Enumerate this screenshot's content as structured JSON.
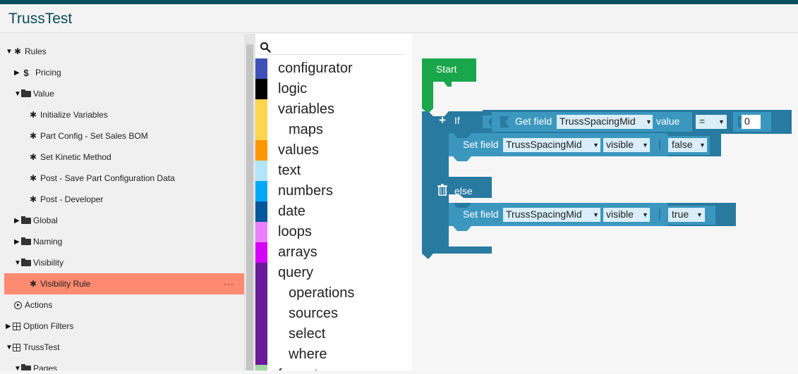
{
  "app": {
    "title": "TrussTest"
  },
  "tree": {
    "items": [
      {
        "label": "Rules",
        "arrow": "▼",
        "icon": "puzzle"
      },
      {
        "label": "Pricing",
        "arrow": "▶",
        "icon": "dollar"
      },
      {
        "label": "Value",
        "arrow": "▼",
        "icon": "folder"
      },
      {
        "label": "Initialize Variables",
        "arrow": "",
        "icon": "puzzle"
      },
      {
        "label": "Part Config - Set Sales BOM",
        "arrow": "",
        "icon": "puzzle"
      },
      {
        "label": "Set Kinetic Method",
        "arrow": "",
        "icon": "puzzle"
      },
      {
        "label": "Post - Save Part Configuration Data",
        "arrow": "",
        "icon": "puzzle"
      },
      {
        "label": "Post - Developer",
        "arrow": "",
        "icon": "puzzle"
      },
      {
        "label": "Global",
        "arrow": "▶",
        "icon": "folder"
      },
      {
        "label": "Naming",
        "arrow": "▶",
        "icon": "folder"
      },
      {
        "label": "Visibility",
        "arrow": "▼",
        "icon": "folder"
      },
      {
        "label": "Visibility Rule",
        "arrow": "",
        "icon": "puzzle",
        "selected": true,
        "menu": "···"
      },
      {
        "label": "Actions",
        "arrow": "",
        "icon": "play-circle"
      },
      {
        "label": "Option Filters",
        "arrow": "▶",
        "icon": "grid"
      },
      {
        "label": "TrussTest",
        "arrow": "▼",
        "icon": "grid"
      },
      {
        "label": "Pages",
        "arrow": "▼",
        "icon": "folder"
      }
    ]
  },
  "toolbox": {
    "search_icon": "search-icon",
    "categories": [
      {
        "label": "configurator",
        "color": "#3f51b5"
      },
      {
        "label": "logic",
        "color": "#000000"
      },
      {
        "label": "variables",
        "color": "#ffd54f"
      },
      {
        "label": "maps",
        "color": "#ffd54f",
        "sub": true
      },
      {
        "label": "values",
        "color": "#ff9800"
      },
      {
        "label": "text",
        "color": "#b3e5fc"
      },
      {
        "label": "numbers",
        "color": "#03a9f4"
      },
      {
        "label": "date",
        "color": "#01579b"
      },
      {
        "label": "loops",
        "color": "#ea80fc"
      },
      {
        "label": "arrays",
        "color": "#d500f9"
      },
      {
        "label": "query",
        "color": "#6a1b9a"
      },
      {
        "label": "operations",
        "color": "#6a1b9a",
        "sub": true
      },
      {
        "label": "sources",
        "color": "#6a1b9a",
        "sub": true
      },
      {
        "label": "select",
        "color": "#6a1b9a",
        "sub": true
      },
      {
        "label": "where",
        "color": "#6a1b9a",
        "sub": true
      },
      {
        "label": "formats",
        "color": "#a5d6a7"
      }
    ]
  },
  "workspace": {
    "colors": {
      "start": "#1aa64a",
      "if_block": "#287aa1",
      "field_block": "#3c97bf",
      "dropdown_bg": "#d9eef8"
    },
    "start": {
      "label": "Start"
    },
    "if_block": {
      "plus_icon": "+",
      "if_label": "If",
      "get_field": {
        "label": "Get field",
        "field": "TrussSpacingMid",
        "prop": "value"
      },
      "compare": {
        "op": "=",
        "value": "0"
      },
      "then": {
        "label": "Set field",
        "field": "TrussSpacingMid",
        "prop": "visible",
        "value": "false"
      },
      "else_label": "else",
      "else": {
        "label": "Set field",
        "field": "TrussSpacingMid",
        "prop": "visible",
        "value": "true"
      }
    }
  }
}
